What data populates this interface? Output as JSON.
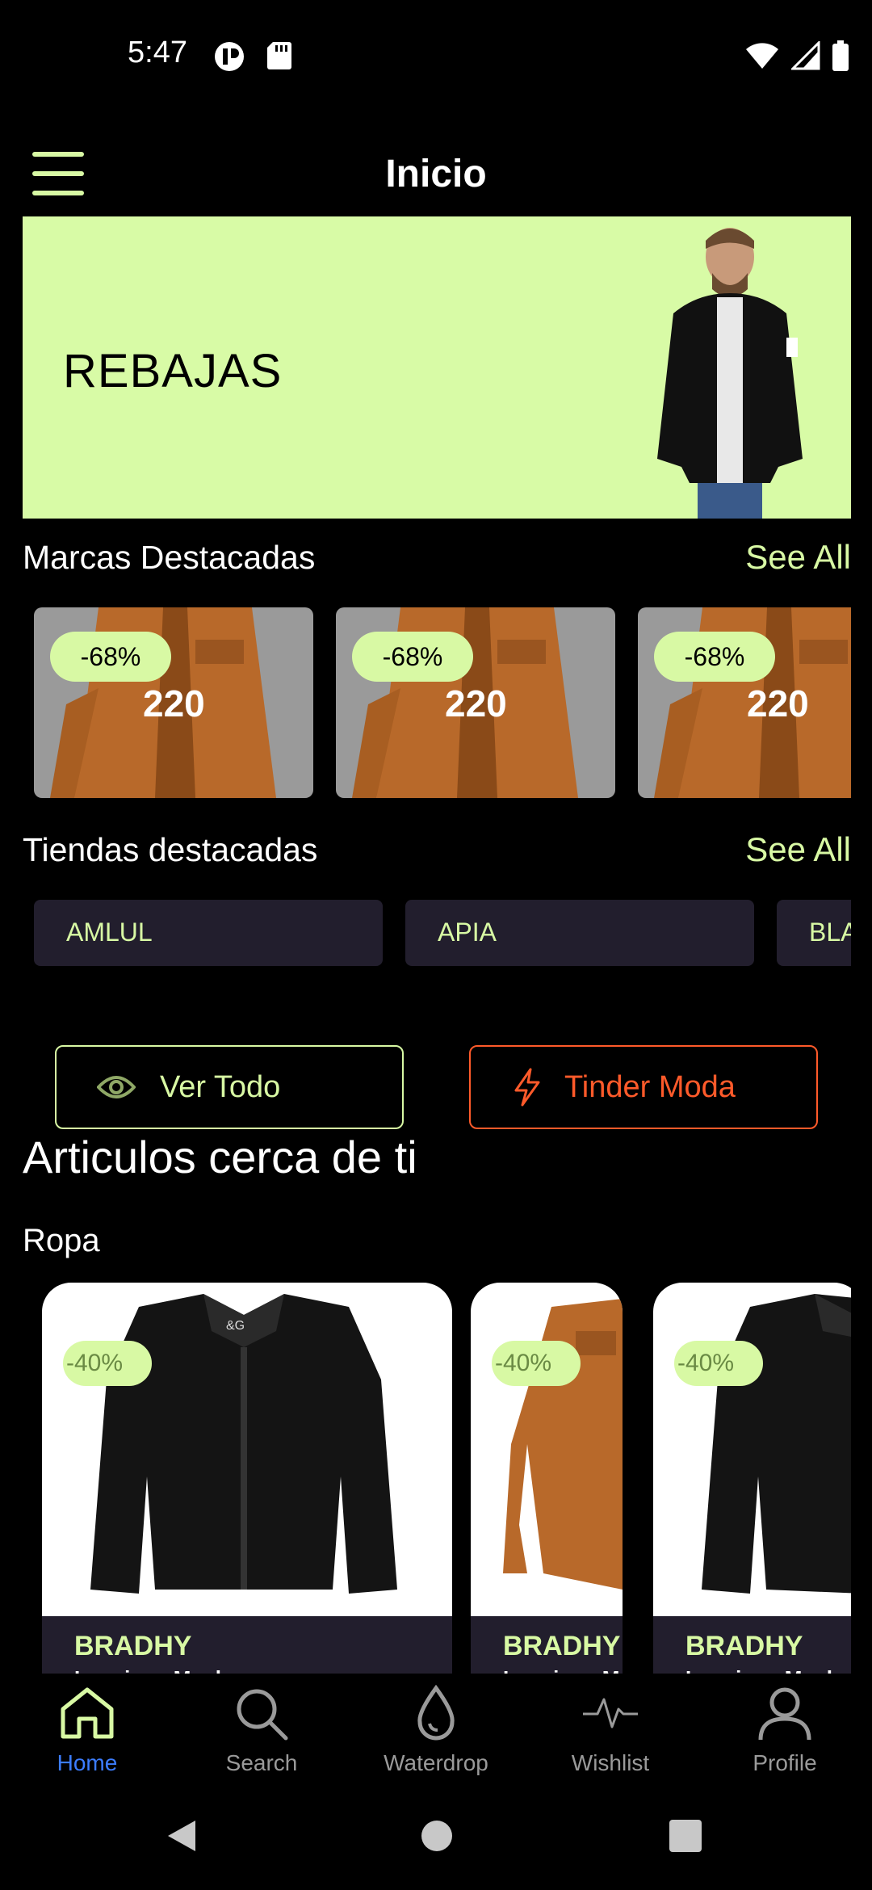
{
  "status": {
    "time": "5:47"
  },
  "appbar": {
    "title": "Inicio"
  },
  "banner": {
    "text": "REBAJAS"
  },
  "brands_section": {
    "title": "Marcas Destacadas",
    "see_all": "See All",
    "cards": [
      {
        "discount": "-68%",
        "price": "220"
      },
      {
        "discount": "-68%",
        "price": "220"
      },
      {
        "discount": "-68%",
        "price": "220"
      }
    ]
  },
  "stores_section": {
    "title": "Tiendas destacadas",
    "see_all": "See All",
    "stores": [
      "AMLUL",
      "APIA",
      "BLA"
    ]
  },
  "actions": {
    "view_all": "Ver Todo",
    "tinder": "Tinder Moda"
  },
  "nearby": {
    "title": "Articulos cerca de ti",
    "category": "Ropa",
    "products": [
      {
        "discount": "-40%",
        "brand": "BRADHY",
        "name": "Leggings Mocha"
      },
      {
        "discount": "-40%",
        "brand": "BRADHY",
        "name": "Leggings M"
      },
      {
        "discount": "-40%",
        "brand": "BRADHY",
        "name": "Leggings Mocha"
      }
    ]
  },
  "bottom_nav": {
    "items": [
      {
        "label": "Home",
        "icon": "home-icon",
        "active": true
      },
      {
        "label": "Search",
        "icon": "search-icon",
        "active": false
      },
      {
        "label": "Waterdrop",
        "icon": "waterdrop-icon",
        "active": false
      },
      {
        "label": "Wishlist",
        "icon": "pulse-icon",
        "active": false
      },
      {
        "label": "Profile",
        "icon": "profile-icon",
        "active": false
      }
    ]
  },
  "colors": {
    "accent": "#d8f9a4",
    "danger": "#ff5a2a",
    "active_nav": "#3c7dff",
    "card_dark": "#221e2d"
  }
}
